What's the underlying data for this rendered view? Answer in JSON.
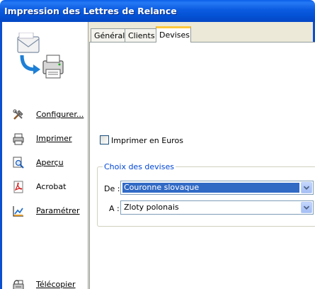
{
  "window": {
    "title": "Impression des Lettres de Relance"
  },
  "sidebar": {
    "items": [
      {
        "label": "Configurer...",
        "icon": "tools-icon"
      },
      {
        "label": "Imprimer",
        "icon": "printer-icon"
      },
      {
        "label": "Aperçu",
        "icon": "preview-icon"
      },
      {
        "label": "Acrobat",
        "icon": "pdf-icon"
      },
      {
        "label": "Paramétrer",
        "icon": "chart-settings-icon"
      },
      {
        "label": "Télécopier",
        "icon": "fax-icon"
      }
    ]
  },
  "tabs": [
    {
      "label": "Général"
    },
    {
      "label": "Clients"
    },
    {
      "label": "Devises",
      "active": true
    }
  ],
  "content": {
    "euro_checkbox": {
      "label": "Imprimer en Euros",
      "checked": false
    },
    "group_title": "Choix des devises",
    "from": {
      "label": "De :",
      "value": "Couronne slovaque"
    },
    "to": {
      "label": "A :",
      "value": "Zloty polonais"
    }
  },
  "colors": {
    "title_bar": "#0a5fe8",
    "selection": "#316ac5",
    "group_title": "#0046d5"
  }
}
